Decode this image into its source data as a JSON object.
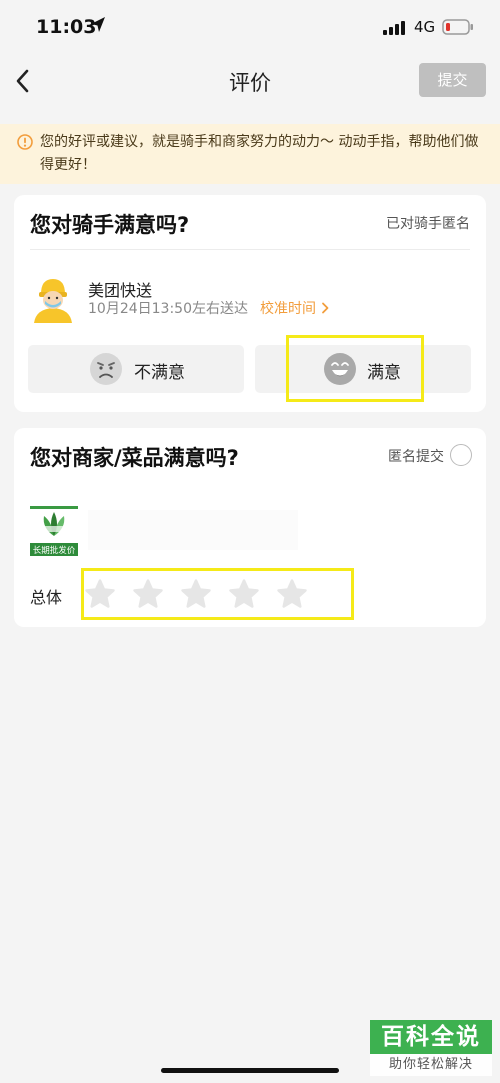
{
  "status_bar": {
    "time": "11:03",
    "network": "4G"
  },
  "nav": {
    "title": "评价",
    "submit_label": "提交"
  },
  "notice": {
    "text": "您的好评或建议，就是骑手和商家努力的动力～ 动动手指，帮助他们做得更好！"
  },
  "rider_card": {
    "title": "您对骑手满意吗?",
    "anonymous_note": "已对骑手匿名",
    "rider_name": "美团快送",
    "delivery_time": "10月24日13:50左右送达",
    "calibrate_label": "校准时间",
    "dissatisfied_label": "不满意",
    "satisfied_label": "满意"
  },
  "merchant_card": {
    "title": "您对商家/菜品满意吗?",
    "anonymous_submit_label": "匿名提交",
    "shop_logo_text": "长期批发价",
    "overall_label": "总体",
    "star_rating": 0,
    "star_max": 5
  },
  "watermark": {
    "title": "百科全说",
    "subtitle": "助你轻松解决"
  },
  "colors": {
    "accent_orange": "#f29d3c",
    "notice_bg": "#fdf3dc",
    "highlight_yellow": "#f5ea18",
    "disabled_button": "#bfbfbf",
    "watermark_green": "#3db150"
  }
}
